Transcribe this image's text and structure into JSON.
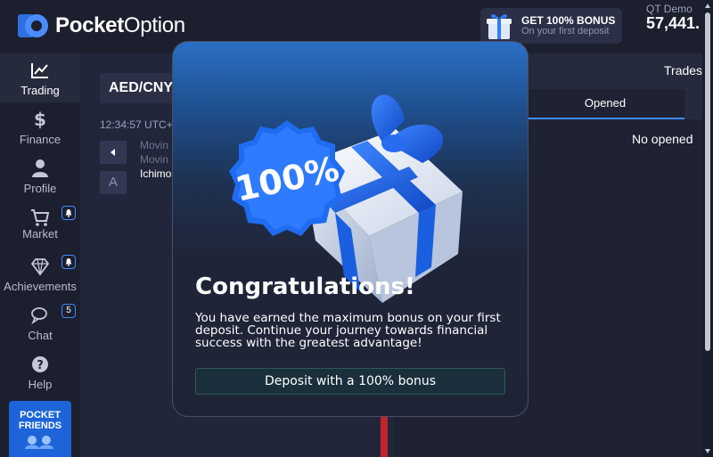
{
  "header": {
    "logo_bold": "Pocket",
    "logo_light": "Option",
    "bonus_title": "GET 100% BONUS",
    "bonus_subtitle": "On your first deposit",
    "account_label": "QT Demo",
    "account_balance": "57,441."
  },
  "sidebar": {
    "items": [
      {
        "label": "Trading",
        "icon": "chart-line-icon",
        "active": true
      },
      {
        "label": "Finance",
        "icon": "dollar-icon"
      },
      {
        "label": "Profile",
        "icon": "user-icon"
      },
      {
        "label": "Market",
        "icon": "cart-icon",
        "badge": "bell"
      },
      {
        "label": "Achievements",
        "icon": "diamond-icon",
        "badge": "bell"
      },
      {
        "label": "Chat",
        "icon": "chat-icon",
        "badge": "5"
      },
      {
        "label": "Help",
        "icon": "question-icon"
      }
    ],
    "friends_line1": "POCKET",
    "friends_line2": "FRIENDS"
  },
  "chart": {
    "asset": "AED/CNY",
    "time": "12:34:57 UTC+",
    "indicator_1": "Movin",
    "indicator_2": "Movin",
    "indicator_3": "Ichimo",
    "font_button": "A"
  },
  "trades": {
    "title": "Trades",
    "tab_opened": "Opened",
    "empty_text": "No opened"
  },
  "modal": {
    "badge_text": "100%",
    "title": "Congratulations!",
    "text": "You have earned the maximum bonus on your first deposit. Continue your journey towards financial success with the greatest advantage!",
    "button": "Deposit with a 100% bonus"
  },
  "colors": {
    "accent_blue": "#3f8cff",
    "bg_dark": "#1f2233",
    "sidebar_bg": "#1c1f2e",
    "red_candle": "#c3232d"
  }
}
